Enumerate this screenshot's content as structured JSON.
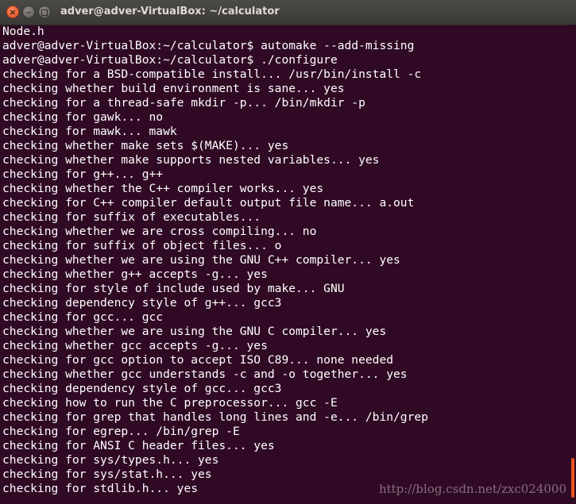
{
  "window": {
    "title": "adver@adver-VirtualBox: ~/calculator",
    "buttons": {
      "close_icon": "close-icon",
      "minimize_icon": "minimize-icon",
      "maximize_icon": "maximize-icon",
      "close_glyph": "×",
      "minimize_glyph": "–"
    }
  },
  "terminal": {
    "lines": [
      "Node.h",
      "adver@adver-VirtualBox:~/calculator$ automake --add-missing",
      "adver@adver-VirtualBox:~/calculator$ ./configure",
      "checking for a BSD-compatible install... /usr/bin/install -c",
      "checking whether build environment is sane... yes",
      "checking for a thread-safe mkdir -p... /bin/mkdir -p",
      "checking for gawk... no",
      "checking for mawk... mawk",
      "checking whether make sets $(MAKE)... yes",
      "checking whether make supports nested variables... yes",
      "checking for g++... g++",
      "checking whether the C++ compiler works... yes",
      "checking for C++ compiler default output file name... a.out",
      "checking for suffix of executables...",
      "checking whether we are cross compiling... no",
      "checking for suffix of object files... o",
      "checking whether we are using the GNU C++ compiler... yes",
      "checking whether g++ accepts -g... yes",
      "checking for style of include used by make... GNU",
      "checking dependency style of g++... gcc3",
      "checking for gcc... gcc",
      "checking whether we are using the GNU C compiler... yes",
      "checking whether gcc accepts -g... yes",
      "checking for gcc option to accept ISO C89... none needed",
      "checking whether gcc understands -c and -o together... yes",
      "checking dependency style of gcc... gcc3",
      "checking how to run the C preprocessor... gcc -E",
      "checking for grep that handles long lines and -e... /bin/grep",
      "checking for egrep... /bin/grep -E",
      "checking for ANSI C header files... yes",
      "checking for sys/types.h... yes",
      "checking for sys/stat.h... yes",
      "checking for stdlib.h... yes"
    ]
  },
  "watermark": "http://blog.csdn.net/zxc024000",
  "colors": {
    "terminal_background": "#300a24",
    "terminal_text": "#ffffff",
    "scroll_thumb": "#e95420",
    "close_button": "#e2531e"
  }
}
